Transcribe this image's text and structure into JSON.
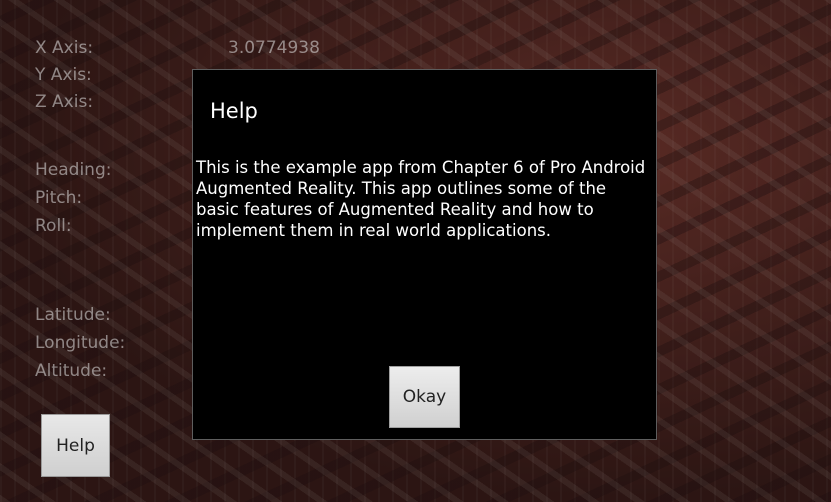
{
  "sensors": {
    "x_axis_label": "X Axis:",
    "y_axis_label": "Y Axis:",
    "z_axis_label": "Z Axis:",
    "x_axis_value": "3.0774938",
    "heading_label": "Heading:",
    "pitch_label": "Pitch:",
    "roll_label": "Roll:",
    "latitude_label": "Latitude:",
    "longitude_label": "Longitude:",
    "altitude_label": "Altitude:"
  },
  "help_button": {
    "label": "Help"
  },
  "dialog": {
    "title": "Help",
    "message": "This is the example app from Chapter 6 of Pro Android Augmented Reality. This app outlines some of the basic features of Augmented Reality and how to implement them in real world applications.",
    "ok_label": "Okay"
  },
  "colors": {
    "dialog_bg": "#000000",
    "dialog_text": "#ffffff",
    "button_bg": "#d9d9d9"
  }
}
